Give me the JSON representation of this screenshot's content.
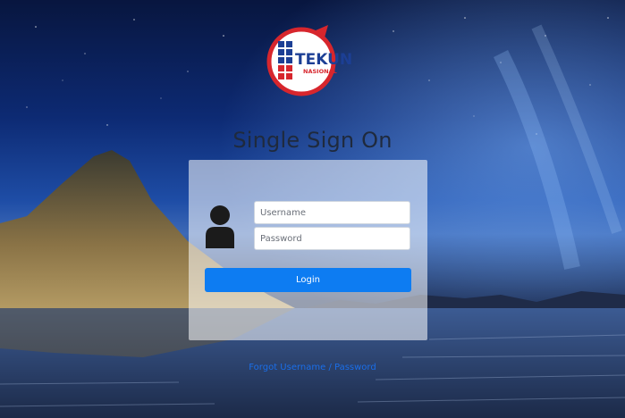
{
  "brand": {
    "logo_text_main": "TEKUN",
    "logo_text_sub": "NASIONAL",
    "color_red": "#d7262d",
    "color_blue": "#1c3f95"
  },
  "page": {
    "title": "Single Sign On"
  },
  "form": {
    "username_placeholder": "Username",
    "username_value": "",
    "password_placeholder": "Password",
    "password_value": "",
    "login_label": "Login",
    "forgot_link": "Forgot Username / Password"
  },
  "icons": {
    "avatar": "user-icon"
  },
  "colors": {
    "button": "#0d7cf2",
    "link": "#1a6ee8",
    "title": "#1f2a3d"
  }
}
